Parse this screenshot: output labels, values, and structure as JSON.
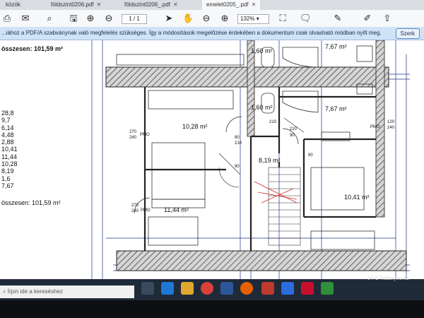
{
  "tabs": [
    {
      "label": "közök"
    },
    {
      "label": "földszint0206.pdf"
    },
    {
      "label": "földszint0206_.pdf"
    },
    {
      "label": "emelet0205_.pdf"
    }
  ],
  "toolbar": {
    "page_current": "1",
    "page_sep": "/ 1",
    "zoom": "132%"
  },
  "infobar": {
    "message": "...iához a PDF/A szabványnak való megfelelés szükséges. Így a módosítások megelőzése érdekében a dokumentum csak olvasható módban nyílt meg.",
    "button": "Szerk"
  },
  "plan": {
    "summary_top": "összesen: 101,59 m²",
    "summary_bottom": "összesen: 101,59 m²",
    "area_list": [
      "28,8",
      "9,7",
      "6,14",
      "4,48",
      "2,88",
      "10,41",
      "11,44",
      "10,28",
      "8,19",
      "1,6",
      "7,67"
    ],
    "rooms": {
      "r1": "1,60 m²",
      "r2": "7,67 m²",
      "r3": "1,60 m²",
      "r4": "7,67 m²",
      "r5": "10,28 m²",
      "r6": "8,19 m²",
      "r7": "10,41 m²",
      "r8": "11,44 m²"
    },
    "dims": [
      "270",
      "240",
      "PMO",
      "210",
      "90",
      "120",
      "240",
      "270",
      "240",
      "80",
      "210",
      "90",
      "210",
      "90",
      "PMO",
      "PMO"
    ]
  },
  "taskbar": {
    "search_placeholder": "Írjon ide a kereséshez",
    "weather": "34°C Többnyire na"
  },
  "colors": {
    "hatch": "#333333",
    "wall_fill": "#cfcfcf",
    "plan_line": "#1f2f8a",
    "stair_red": "#d23030",
    "taskbar": "#1f2a38"
  }
}
